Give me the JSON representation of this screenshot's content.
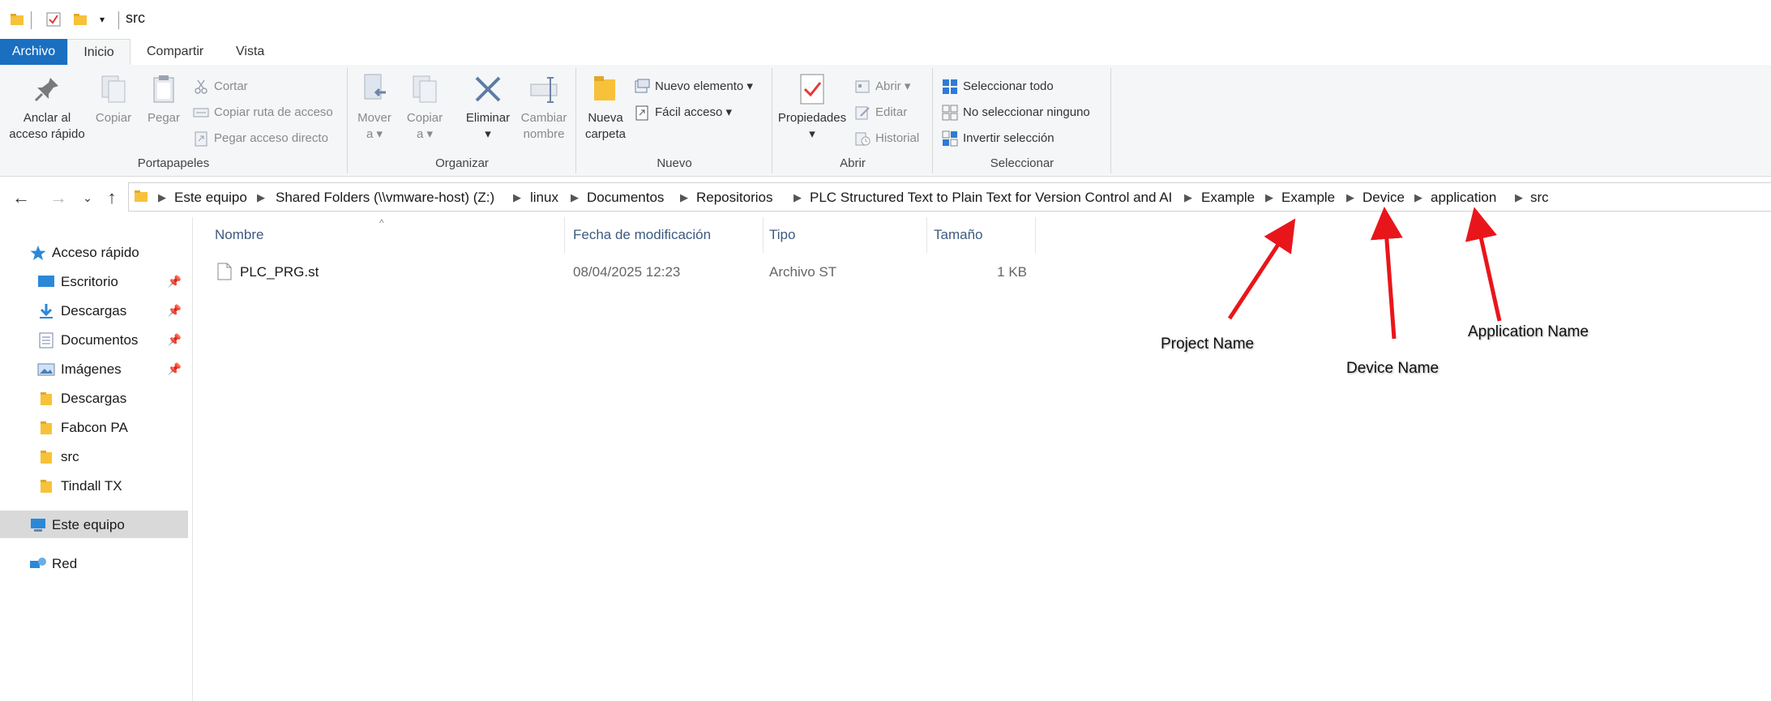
{
  "window": {
    "title": "src"
  },
  "ribbon_tabs": [
    "Archivo",
    "Inicio",
    "Compartir",
    "Vista"
  ],
  "ribbon": {
    "portapapeles": {
      "label": "Portapapeles",
      "pin_quick_access": [
        "Anclar al",
        "acceso rápido"
      ],
      "copy": "Copiar",
      "paste": "Pegar",
      "cut": "Cortar",
      "copy_path": "Copiar ruta de acceso",
      "paste_shortcut": "Pegar acceso directo"
    },
    "organizar": {
      "label": "Organizar",
      "move_to": [
        "Mover",
        "a"
      ],
      "copy_to": [
        "Copiar",
        "a"
      ],
      "delete": "Eliminar",
      "rename": [
        "Cambiar",
        "nombre"
      ]
    },
    "nuevo": {
      "label": "Nuevo",
      "new_folder": [
        "Nueva",
        "carpeta"
      ],
      "new_item": "Nuevo elemento",
      "easy_access": "Fácil acceso"
    },
    "abrir": {
      "label": "Abrir",
      "properties": "Propiedades",
      "open": "Abrir",
      "edit": "Editar",
      "history": "Historial"
    },
    "seleccionar": {
      "label": "Seleccionar",
      "select_all": "Seleccionar todo",
      "select_none": "No seleccionar ninguno",
      "invert": "Invertir selección"
    }
  },
  "breadcrumb": [
    "Este equipo",
    "Shared Folders (\\\\vmware-host) (Z:)",
    "linux",
    "Documentos",
    "Repositorios",
    "PLC Structured Text to Plain Text for Version Control and AI",
    "Example",
    "Example",
    "Device",
    "application",
    "src"
  ],
  "sidebar": {
    "quick_access": "Acceso rápido",
    "items": [
      {
        "label": "Escritorio",
        "icon": "desktop-icon",
        "pinned": true
      },
      {
        "label": "Descargas",
        "icon": "download-icon",
        "pinned": true
      },
      {
        "label": "Documentos",
        "icon": "documents-icon",
        "pinned": true
      },
      {
        "label": "Imágenes",
        "icon": "pictures-icon",
        "pinned": true
      },
      {
        "label": "Descargas",
        "icon": "folder-icon",
        "pinned": false
      },
      {
        "label": "Fabcon PA",
        "icon": "folder-icon",
        "pinned": false
      },
      {
        "label": "src",
        "icon": "folder-icon",
        "pinned": false
      },
      {
        "label": "Tindall TX",
        "icon": "folder-icon",
        "pinned": false
      }
    ],
    "this_pc": "Este equipo",
    "network": "Red"
  },
  "columns": [
    "Nombre",
    "Fecha de modificación",
    "Tipo",
    "Tamaño"
  ],
  "files": [
    {
      "name": "PLC_PRG.st",
      "modified": "08/04/2025 12:23",
      "type": "Archivo ST",
      "size": "1 KB"
    }
  ],
  "annotations": {
    "project": "Project Name",
    "device": "Device Name",
    "application": "Application Name"
  },
  "colors": {
    "accent": "#1a6fc1",
    "arrow": "#e8161b",
    "folder": "#f7c23a"
  }
}
